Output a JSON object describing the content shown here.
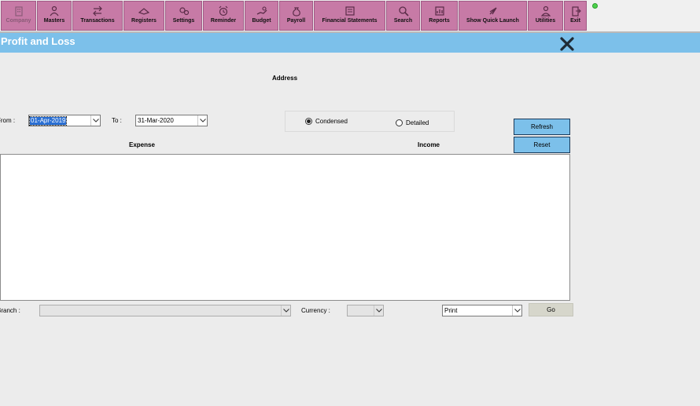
{
  "toolbar": {
    "items": [
      {
        "label": "Company",
        "icon": "company-icon",
        "disabled": true
      },
      {
        "label": "Masters",
        "icon": "masters-icon"
      },
      {
        "label": "Transactions",
        "icon": "transactions-icon"
      },
      {
        "label": "Registers",
        "icon": "registers-icon"
      },
      {
        "label": "Settings",
        "icon": "settings-icon"
      },
      {
        "label": "Reminder",
        "icon": "alarm-clock-icon"
      },
      {
        "label": "Budget",
        "icon": "budget-icon"
      },
      {
        "label": "Payroll",
        "icon": "money-bag-icon"
      },
      {
        "label": "Financial Statements",
        "icon": "statements-icon"
      },
      {
        "label": "Search",
        "icon": "search-icon"
      },
      {
        "label": "Reports",
        "icon": "reports-icon"
      },
      {
        "label": "Show Quick Launch",
        "icon": "rocket-icon"
      },
      {
        "label": "Utilities",
        "icon": "utilities-icon"
      },
      {
        "label": "Exit",
        "icon": "exit-icon"
      }
    ]
  },
  "window": {
    "title": "Profit and Loss",
    "close_icon": "close-icon"
  },
  "address_label": "Address",
  "filters": {
    "from_label": "From :",
    "from_value": "01-Apr-2019",
    "to_label": "To :",
    "to_value": "31-Mar-2020"
  },
  "view_mode": {
    "options": [
      {
        "label": "Condensed",
        "selected": true
      },
      {
        "label": "Detailed",
        "selected": false
      }
    ]
  },
  "actions": {
    "refresh_label": "Refresh",
    "reset_label": "Reset"
  },
  "columns": {
    "expense": "Expense",
    "income": "Income"
  },
  "footer": {
    "branch_label": "Branch :",
    "branch_value": "",
    "currency_label": "Currency :",
    "currency_value": "",
    "print_value": "Print",
    "go_label": "Go"
  },
  "colors": {
    "toolbar": "#c77aa6",
    "titlebar": "#7cc0ea",
    "accent_button": "#7cc0ea"
  }
}
